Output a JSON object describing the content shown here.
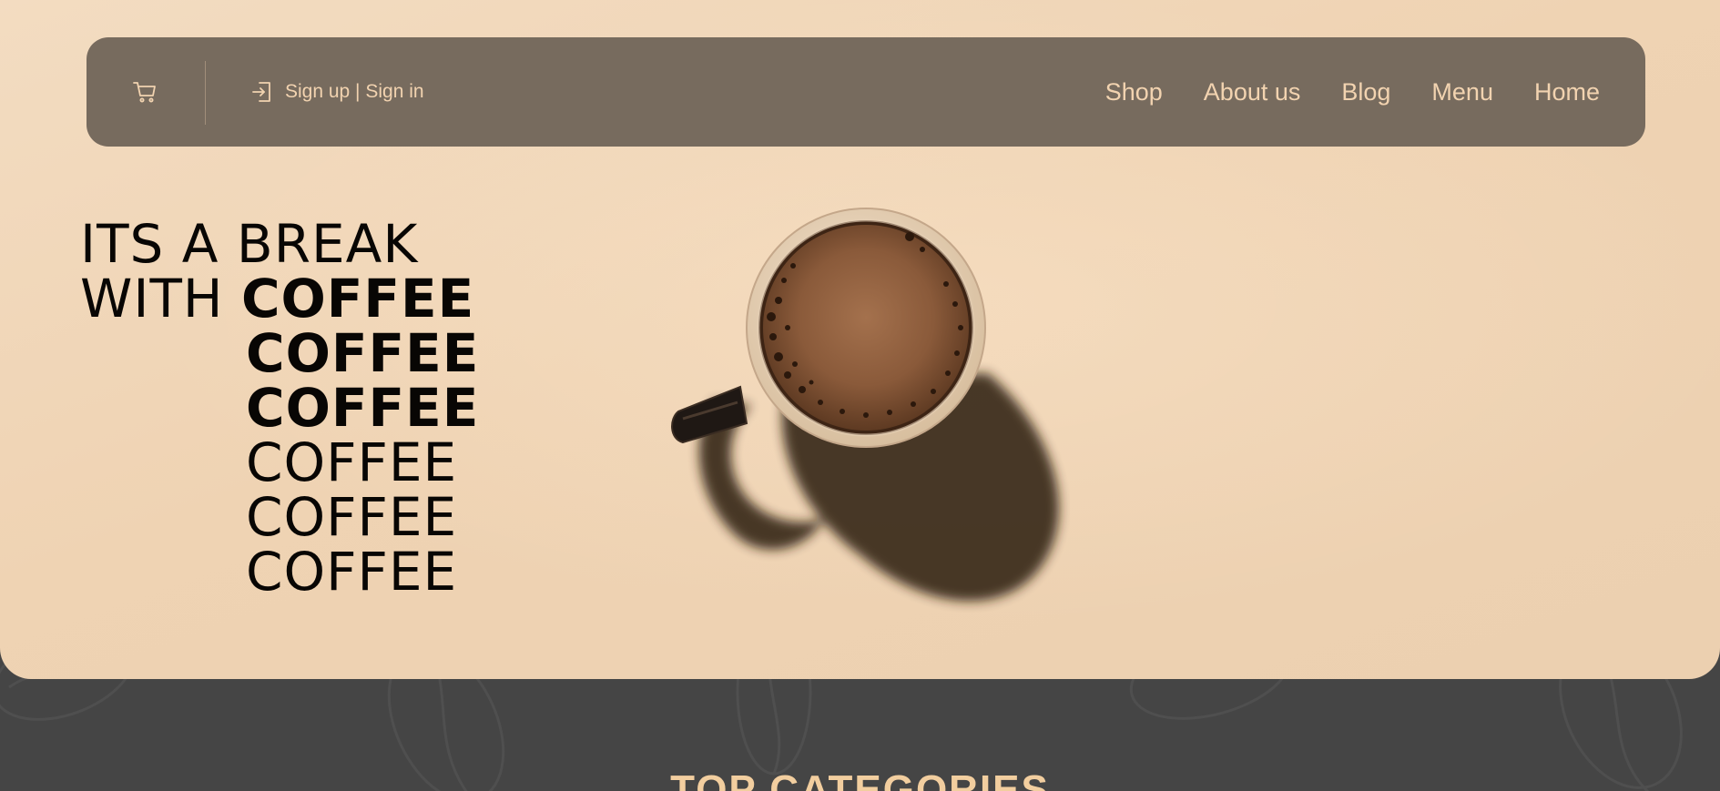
{
  "header": {
    "cart_icon": "shopping-cart-icon",
    "signin_icon": "sign-in-icon",
    "signin_label": "Sign up | Sign in",
    "nav": [
      "Shop",
      "About us",
      "Blog",
      "Menu",
      "Home"
    ]
  },
  "hero": {
    "line1": "ITS A BREAK",
    "line2_prefix": "WITH",
    "coffee_words": [
      "COFFEE",
      "COFFEE",
      "COFFEE",
      "COFFEE",
      "COFFEE",
      "COFFEE"
    ],
    "image": "coffee-cup-top-view"
  },
  "section": {
    "title": "TOP CATEGORIES"
  },
  "colors": {
    "nav_bg": "#776b5e",
    "nav_text": "#f2d3b0",
    "hero_bg": "#efd3b3",
    "dark_bg": "#454545",
    "accent": "#f2ce9f"
  }
}
